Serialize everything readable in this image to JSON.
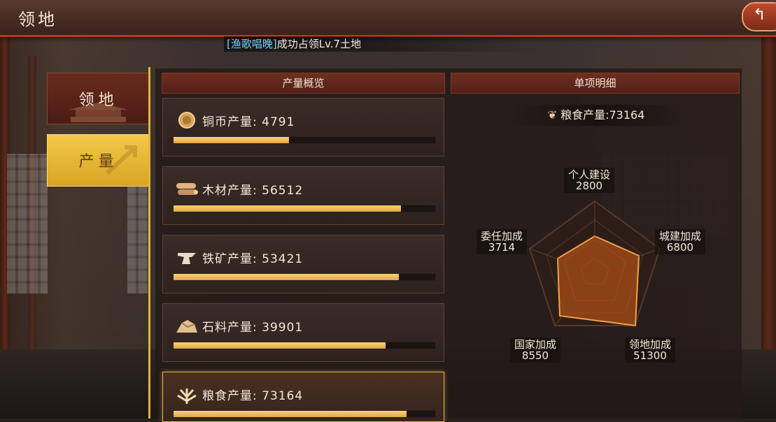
{
  "header": {
    "title": "领地",
    "back_label": "↰"
  },
  "notice": {
    "player": "[渔歌唱晚]",
    "message": "成功占领Lv.7土地"
  },
  "tabs": [
    {
      "label": "领地"
    },
    {
      "label": "产量"
    }
  ],
  "overview": {
    "title": "产量概览",
    "rows": [
      {
        "icon": "coin-icon",
        "label": "铜币产量: ",
        "value": "4791",
        "progress": 0.44
      },
      {
        "icon": "wood-icon",
        "label": "木材产量: ",
        "value": "56512",
        "progress": 0.87
      },
      {
        "icon": "iron-icon",
        "label": "铁矿产量: ",
        "value": "53421",
        "progress": 0.86
      },
      {
        "icon": "stone-icon",
        "label": "石料产量: ",
        "value": "39901",
        "progress": 0.81
      },
      {
        "icon": "grain-icon",
        "label": "粮食产量: ",
        "value": "73164",
        "progress": 0.89
      }
    ]
  },
  "detail": {
    "title": "单项明细",
    "total_label": "粮食产量:",
    "total_value": "73164",
    "stats": [
      {
        "label": "个人建设",
        "value": "2800"
      },
      {
        "label": "城建加成",
        "value": "6800"
      },
      {
        "label": "领地加成",
        "value": "51300"
      },
      {
        "label": "国家加成",
        "value": "8550"
      },
      {
        "label": "委任加成",
        "value": "3714"
      }
    ]
  },
  "colors": {
    "accent": "#e3a640",
    "active_tab": "#f2c94a",
    "header_line": "#b23a1e",
    "link": "#6fd2ff"
  }
}
